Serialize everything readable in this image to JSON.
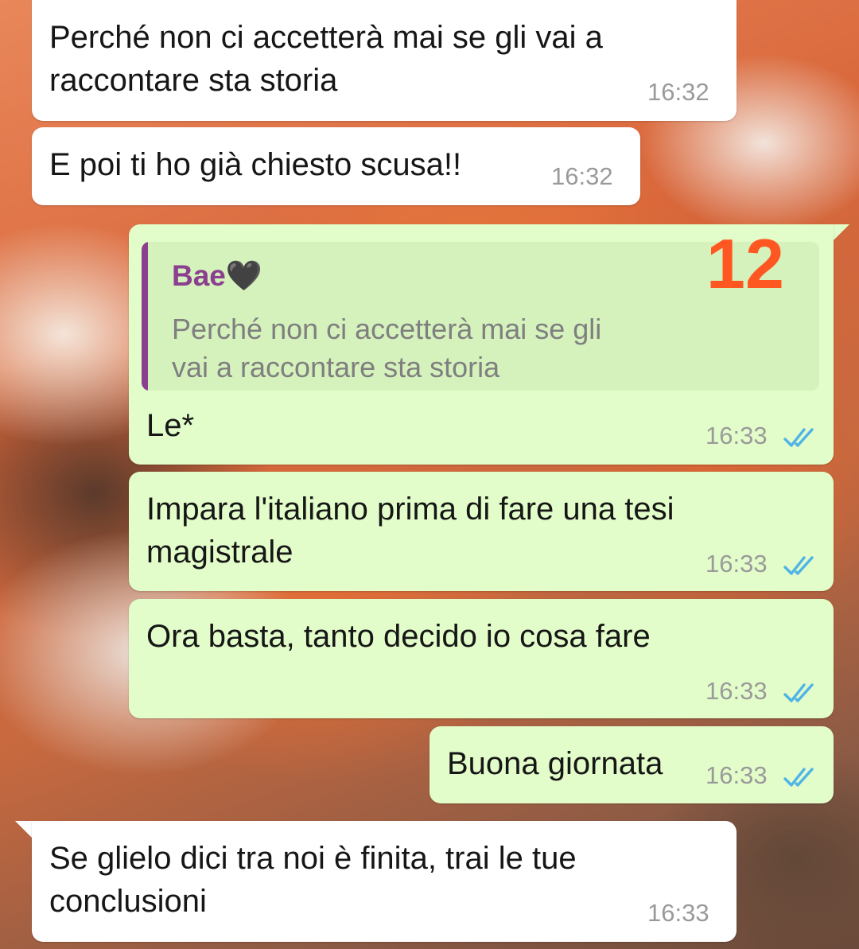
{
  "messages": [
    {
      "direction": "incoming",
      "lines": [
        "Perché non ci accetterà mai se gli vai a",
        "raccontare sta storia"
      ],
      "time": "16:32"
    },
    {
      "direction": "incoming",
      "lines": [
        "E poi ti ho già chiesto scusa!!"
      ],
      "time": "16:32"
    },
    {
      "direction": "outgoing",
      "reply_to": {
        "author": "Bae🖤",
        "lines": [
          "Perché non ci accetterà mai se gli",
          "vai a raccontare sta storia"
        ]
      },
      "lines": [
        "Le*"
      ],
      "time": "16:33",
      "status": "read"
    },
    {
      "direction": "outgoing",
      "lines": [
        "Impara l'italiano prima di fare una tesi",
        "magistrale"
      ],
      "time": "16:33",
      "status": "read"
    },
    {
      "direction": "outgoing",
      "lines": [
        "Ora basta, tanto decido io cosa fare"
      ],
      "time": "16:33",
      "status": "read"
    },
    {
      "direction": "outgoing",
      "lines": [
        "Buona giornata"
      ],
      "time": "16:33",
      "status": "read"
    },
    {
      "direction": "incoming",
      "lines": [
        "Se glielo dici tra noi è finita, trai le tue",
        "conclusioni"
      ],
      "time": "16:33"
    }
  ],
  "overlay_number": "12",
  "colors": {
    "incoming_bubble": "#ffffff",
    "outgoing_bubble": "#e2fdc9",
    "quote_background": "#d5f1bc",
    "quote_author": "#8a3f8f",
    "read_ticks": "#4fb3e8",
    "overlay_number": "#ff5722",
    "timestamp": "#9a9a9a"
  },
  "icons": {
    "read_status": "double-check-icon",
    "reply_bar": "quote-bar"
  }
}
